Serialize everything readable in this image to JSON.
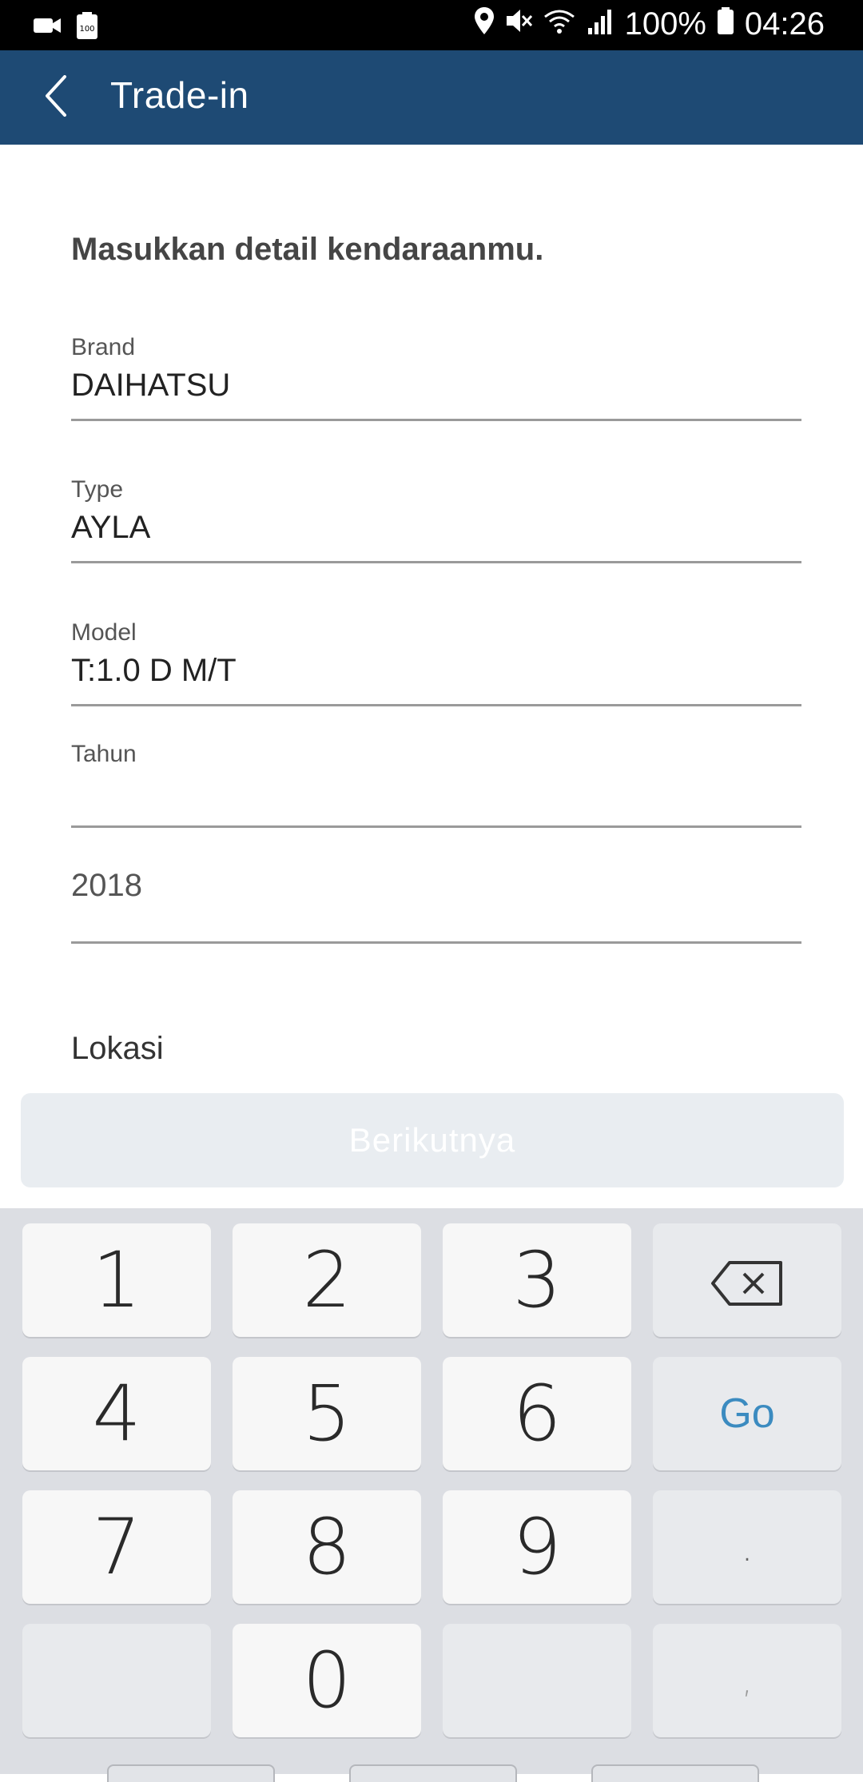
{
  "status_bar": {
    "battery_percent": "100%",
    "time": "04:26",
    "icons_left": [
      "video-camera-icon",
      "battery-100-icon"
    ],
    "icons_right": [
      "location-icon",
      "mute-icon",
      "wifi-icon",
      "signal-icon",
      "battery-icon"
    ]
  },
  "app_bar": {
    "title": "Trade-in",
    "back_icon": "chevron-left-icon",
    "color": "#1e4a74"
  },
  "form": {
    "heading": "Masukkan detail kendaraanmu.",
    "fields": [
      {
        "label": "Brand",
        "value": "DAIHATSU"
      },
      {
        "label": "Type",
        "value": "AYLA"
      },
      {
        "label": "Model",
        "value": "T:1.0 D M/T"
      },
      {
        "label": "Tahun",
        "value": ""
      }
    ],
    "year_input_value": "2018",
    "lokasi_label": "Lokasi"
  },
  "next_button": {
    "label": "Berikutnya",
    "disabled": true
  },
  "keyboard": {
    "keys": [
      "1",
      "2",
      "3",
      "backspace",
      "4",
      "5",
      "6",
      "Go",
      "7",
      "8",
      "9",
      ".",
      "",
      "0",
      "",
      ","
    ],
    "go_label": "Go",
    "accent": "#3b8bc0"
  }
}
